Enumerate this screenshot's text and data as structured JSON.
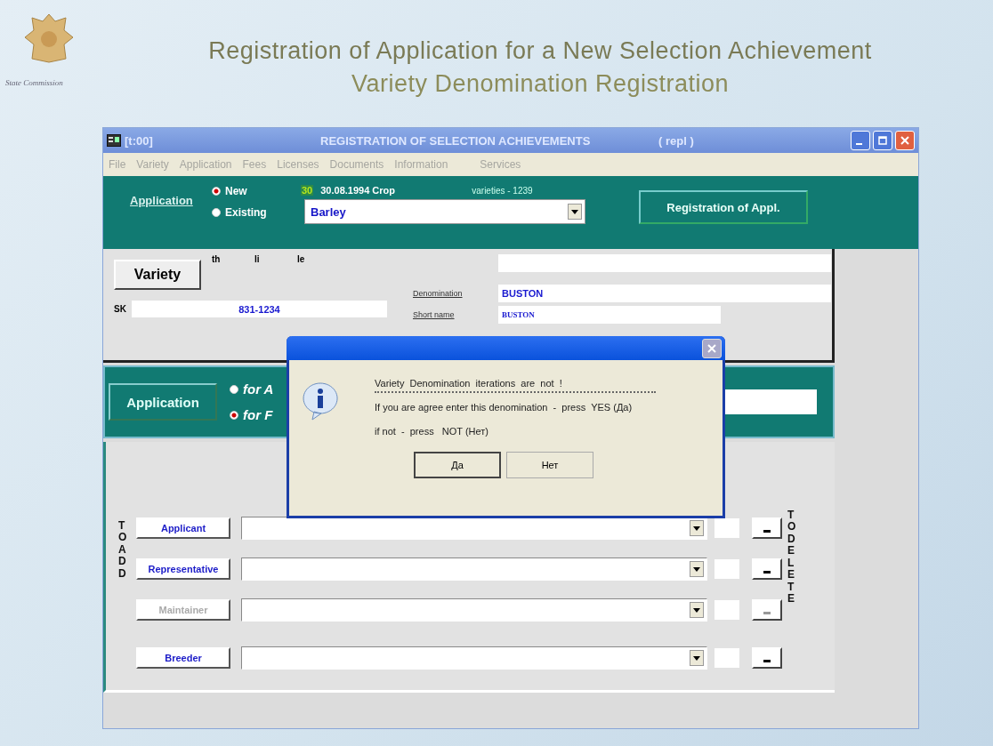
{
  "slide": {
    "org": "State Commission",
    "title": "Registration of Application for a New Selection Achievement",
    "subtitle": "Variety Denomination Registration"
  },
  "window": {
    "code": "[t:00]",
    "title": "REGISTRATION OF SELECTION ACHIEVEMENTS",
    "mode": "( repl )"
  },
  "menu": [
    "File",
    "Variety",
    "Application",
    "Fees",
    "Licenses",
    "Documents",
    "Information",
    "Services"
  ],
  "application_bar": {
    "link": "Application",
    "options": [
      {
        "label": "New",
        "selected": true
      },
      {
        "label": "Existing",
        "selected": false
      }
    ],
    "day": "30",
    "date": "30.08.1994 Crop",
    "count": "varieties - 1239",
    "crop": "Barley",
    "register_button": "Registration of Appl."
  },
  "variety": {
    "button": "Variety",
    "headings": [
      "th",
      "li",
      "le"
    ],
    "sk_label": "SK",
    "sk": "831-1234",
    "denomination_label": "Denomination",
    "denomination": "BUSTON",
    "short_name_label": "Short name",
    "short_name": "BUSTON"
  },
  "application_type": {
    "button": "Application",
    "options": [
      {
        "label": "for A",
        "selected": false
      },
      {
        "label": "for F",
        "selected": true
      }
    ]
  },
  "parties": {
    "add_label": "TO ADD",
    "delete_label": "TO DELETE",
    "rows": [
      {
        "button": "Applicant",
        "disabled": false
      },
      {
        "button": "Representative",
        "disabled": false
      },
      {
        "button": "Maintainer",
        "disabled": true
      },
      {
        "button": "Breeder",
        "disabled": false
      }
    ]
  },
  "dialog": {
    "lines": [
      "Variety  Denomination  iterations  are  not  !",
      "If you are agree enter this denomination  -  press  YES (Да)",
      "if not  -  press   NOT (Нет)"
    ],
    "buttons": [
      {
        "label": "Да",
        "default": true
      },
      {
        "label": "Нет",
        "default": false
      }
    ]
  }
}
